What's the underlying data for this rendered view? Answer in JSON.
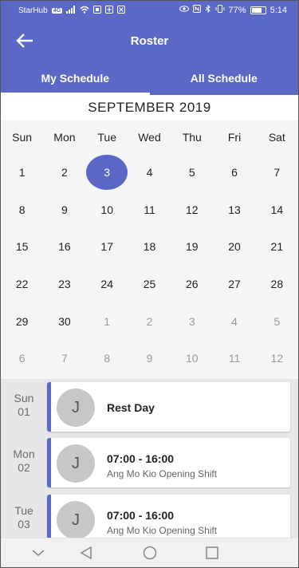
{
  "status_bar": {
    "carrier": "StarHub",
    "network_badge": "4G",
    "battery_percent_label": "77%",
    "battery_level": 0.77,
    "time": "5:14"
  },
  "app_bar": {
    "title": "Roster",
    "back_icon": "arrow-left-icon"
  },
  "tabs": [
    {
      "label": "My Schedule",
      "active": true
    },
    {
      "label": "All Schedule",
      "active": false
    }
  ],
  "calendar": {
    "month_title": "SEPTEMBER 2019",
    "weekdays": [
      "Sun",
      "Mon",
      "Tue",
      "Wed",
      "Thu",
      "Fri",
      "Sat"
    ],
    "weeks": [
      [
        "1",
        "2",
        "3",
        "4",
        "5",
        "6",
        "7"
      ],
      [
        "8",
        "9",
        "10",
        "11",
        "12",
        "13",
        "14"
      ],
      [
        "15",
        "16",
        "17",
        "18",
        "19",
        "20",
        "21"
      ],
      [
        "22",
        "23",
        "24",
        "25",
        "26",
        "27",
        "28"
      ],
      [
        "29",
        "30",
        "1",
        "2",
        "3",
        "4",
        "5"
      ],
      [
        "6",
        "7",
        "8",
        "9",
        "10",
        "11",
        "12"
      ]
    ],
    "selected_day": "3",
    "selected_color": "#5b68c6"
  },
  "schedule": [
    {
      "day": "Sun",
      "date": "01",
      "avatar": "J",
      "title": "Rest Day",
      "subtitle": ""
    },
    {
      "day": "Mon",
      "date": "02",
      "avatar": "J",
      "title": "07:00 - 16:00",
      "subtitle": "Ang Mo Kio Opening Shift"
    },
    {
      "day": "Tue",
      "date": "03",
      "avatar": "J",
      "title": "07:00 - 16:00",
      "subtitle": "Ang Mo Kio Opening Shift"
    }
  ],
  "nav_bar": {
    "icons": [
      "chevron-down-icon",
      "back-triangle-icon",
      "home-circle-icon",
      "recents-square-icon"
    ]
  },
  "colors": {
    "primary": "#5b68c6"
  }
}
